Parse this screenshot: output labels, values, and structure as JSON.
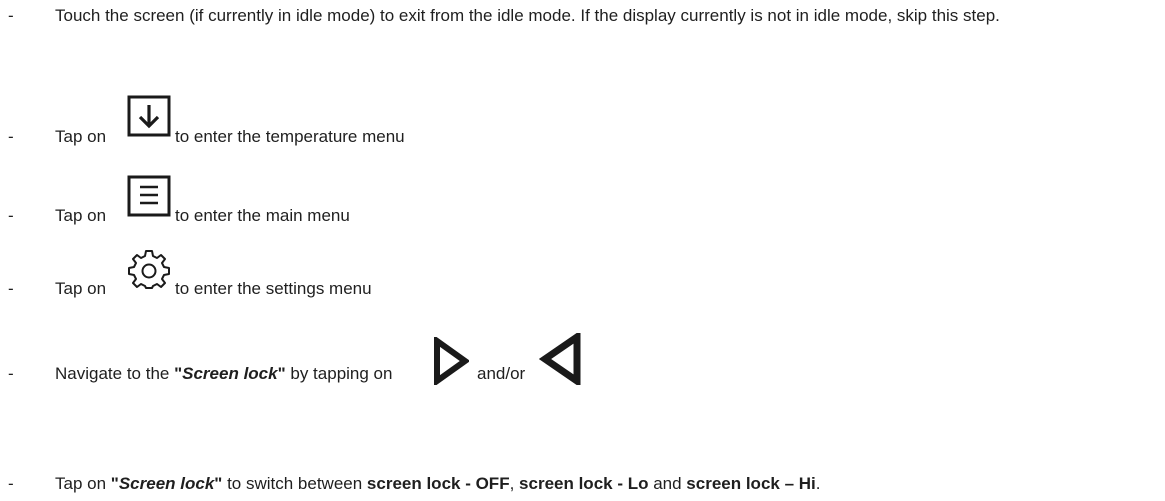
{
  "steps": [
    {
      "dash": "-",
      "text": "Touch the screen (if currently in idle mode) to exit from the idle mode. If the display currently is not in idle mode, skip this step."
    },
    {
      "dash": "-",
      "before": "Tap on",
      "icon": "arrow-down-box-icon",
      "after": "to enter the temperature menu"
    },
    {
      "dash": "-",
      "before": "Tap on",
      "icon": "menu-box-icon",
      "after": "to enter the main menu"
    },
    {
      "dash": "-",
      "before": "Tap on",
      "icon": "gear-icon",
      "after": "to enter the settings menu"
    },
    {
      "dash": "-",
      "before": "Navigate to the ",
      "quote_open": "\"",
      "emphasis": "Screen lock",
      "quote_close": "\"",
      "middle": " by tapping on",
      "icon_right": "triangle-right-icon",
      "and_or": "and/or",
      "icon_left": "triangle-left-icon"
    },
    {
      "dash": "-",
      "before": "Tap on ",
      "quote_open": "\"",
      "emphasis": "Screen lock",
      "quote_close": "\"",
      "middle": " to switch between ",
      "opt1": "screen lock - OFF",
      "sep1": ", ",
      "opt2": "screen lock - Lo",
      "sep2": " and ",
      "opt3": "screen lock – Hi",
      "end": "."
    }
  ]
}
